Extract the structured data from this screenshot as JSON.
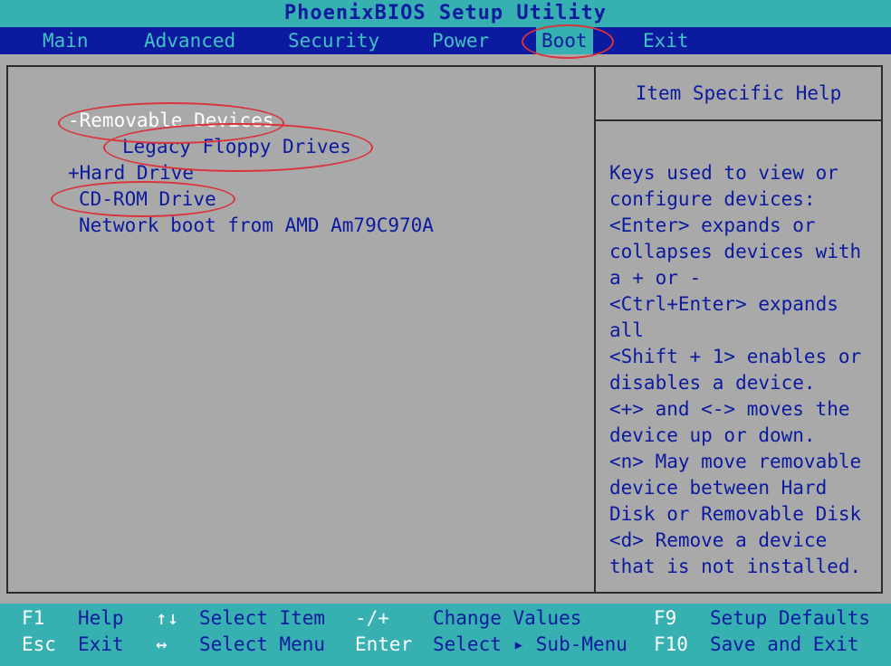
{
  "title": "PhoenixBIOS Setup Utility",
  "menu": {
    "main": "Main",
    "advanced": "Advanced",
    "security": "Security",
    "power": "Power",
    "boot": "Boot",
    "exit": "Exit"
  },
  "boot_list": {
    "removable_devices": "-Removable Devices",
    "legacy_floppy": "Legacy Floppy Drives",
    "hard_drive": "+Hard Drive",
    "cdrom": "CD-ROM Drive",
    "network": "Network boot from AMD Am79C970A"
  },
  "help": {
    "title": "Item Specific Help",
    "text": "Keys used to view or\nconfigure devices:\n<Enter> expands or\ncollapses devices with\na + or -\n<Ctrl+Enter> expands\nall\n<Shift + 1> enables or\ndisables a device.\n<+> and <-> moves the\ndevice up or down.\n<n> May move removable\ndevice between Hard\nDisk or Removable Disk\n<d> Remove a device\nthat is not installed."
  },
  "status": {
    "f1_key": "F1",
    "f1_desc": "Help",
    "updown_key": "↑↓",
    "updown_desc": "Select Item",
    "minusplus_key": "-/+",
    "minusplus_desc": "Change Values",
    "f9_key": "F9",
    "f9_desc": "Setup Defaults",
    "esc_key": "Esc",
    "esc_desc": "Exit",
    "leftright_key": "↔",
    "leftright_desc": "Select Menu",
    "enter_key": "Enter",
    "enter_desc": "Select ▸ Sub-Menu",
    "f10_key": "F10",
    "f10_desc": "Save and Exit"
  },
  "colors": {
    "bios_blue": "#0b1a9e",
    "bios_cyan": "#36b0b0",
    "bios_gray": "#a9a9a9",
    "annotation_red": "#d9333c"
  }
}
